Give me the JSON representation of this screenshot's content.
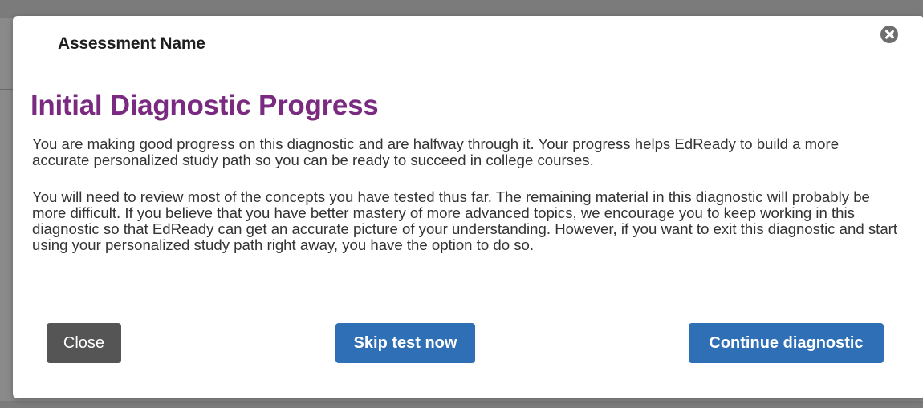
{
  "modal": {
    "header_title": "Assessment Name",
    "close_icon": "close-circle-icon",
    "heading": "Initial Diagnostic Progress",
    "paragraphs": [
      "You are making good progress on this diagnostic and are halfway through it. Your progress helps EdReady to build a more accurate personalized study path so you can be ready to succeed in college courses.",
      "You will need to review most of the concepts you have tested thus far. The remaining material in this diagnostic will probably be more difficult. If you believe that you have better mastery of more advanced topics, we encourage you to keep working in this diagnostic so that EdReady can get an accurate picture of your understanding. However, if you want to exit this diagnostic and start using your personalized study path right away, you have the option to do so."
    ],
    "buttons": {
      "close": "Close",
      "skip": "Skip test now",
      "continue": "Continue diagnostic"
    }
  },
  "colors": {
    "heading": "#7a2a80",
    "primary_button": "#2e6fb5",
    "secondary_button": "#555555",
    "backdrop": "#7b7b7b"
  }
}
